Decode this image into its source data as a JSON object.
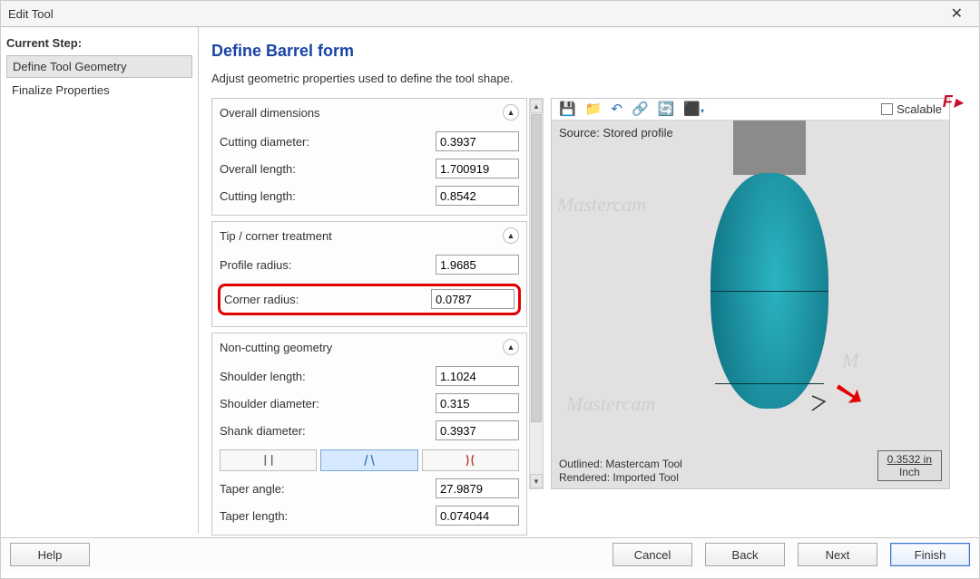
{
  "window": {
    "title": "Edit Tool"
  },
  "sidebar": {
    "heading": "Current Step:",
    "steps": [
      {
        "label": "Define Tool Geometry"
      },
      {
        "label": "Finalize Properties"
      }
    ]
  },
  "page": {
    "title": "Define Barrel form",
    "subtitle": "Adjust geometric properties used to define the tool shape."
  },
  "groups": {
    "overall": {
      "title": "Overall dimensions",
      "cutting_diameter": {
        "label": "Cutting diameter:",
        "value": "0.3937"
      },
      "overall_length": {
        "label": "Overall length:",
        "value": "1.700919"
      },
      "cutting_length": {
        "label": "Cutting length:",
        "value": "0.8542"
      }
    },
    "tip": {
      "title": "Tip / corner treatment",
      "profile_radius": {
        "label": "Profile radius:",
        "value": "1.9685"
      },
      "corner_radius": {
        "label": "Corner radius:",
        "value": "0.0787"
      }
    },
    "noncut": {
      "title": "Non-cutting geometry",
      "shoulder_length": {
        "label": "Shoulder length:",
        "value": "1.1024"
      },
      "shoulder_diameter": {
        "label": "Shoulder diameter:",
        "value": "0.315"
      },
      "shank_diameter": {
        "label": "Shank diameter:",
        "value": "0.3937"
      },
      "taper_angle": {
        "label": "Taper angle:",
        "value": "27.9879"
      },
      "taper_length": {
        "label": "Taper length:",
        "value": "0.074044"
      }
    }
  },
  "preview": {
    "source": "Source: Stored profile",
    "outlined": "Outlined: Mastercam Tool",
    "rendered": "Rendered: Imported Tool",
    "scalable_label": "Scalable",
    "ruler_value": "0.3532 in",
    "ruler_unit": "Inch",
    "watermark": "Mastercam"
  },
  "buttons": {
    "help": "Help",
    "cancel": "Cancel",
    "back": "Back",
    "next": "Next",
    "finish": "Finish"
  }
}
